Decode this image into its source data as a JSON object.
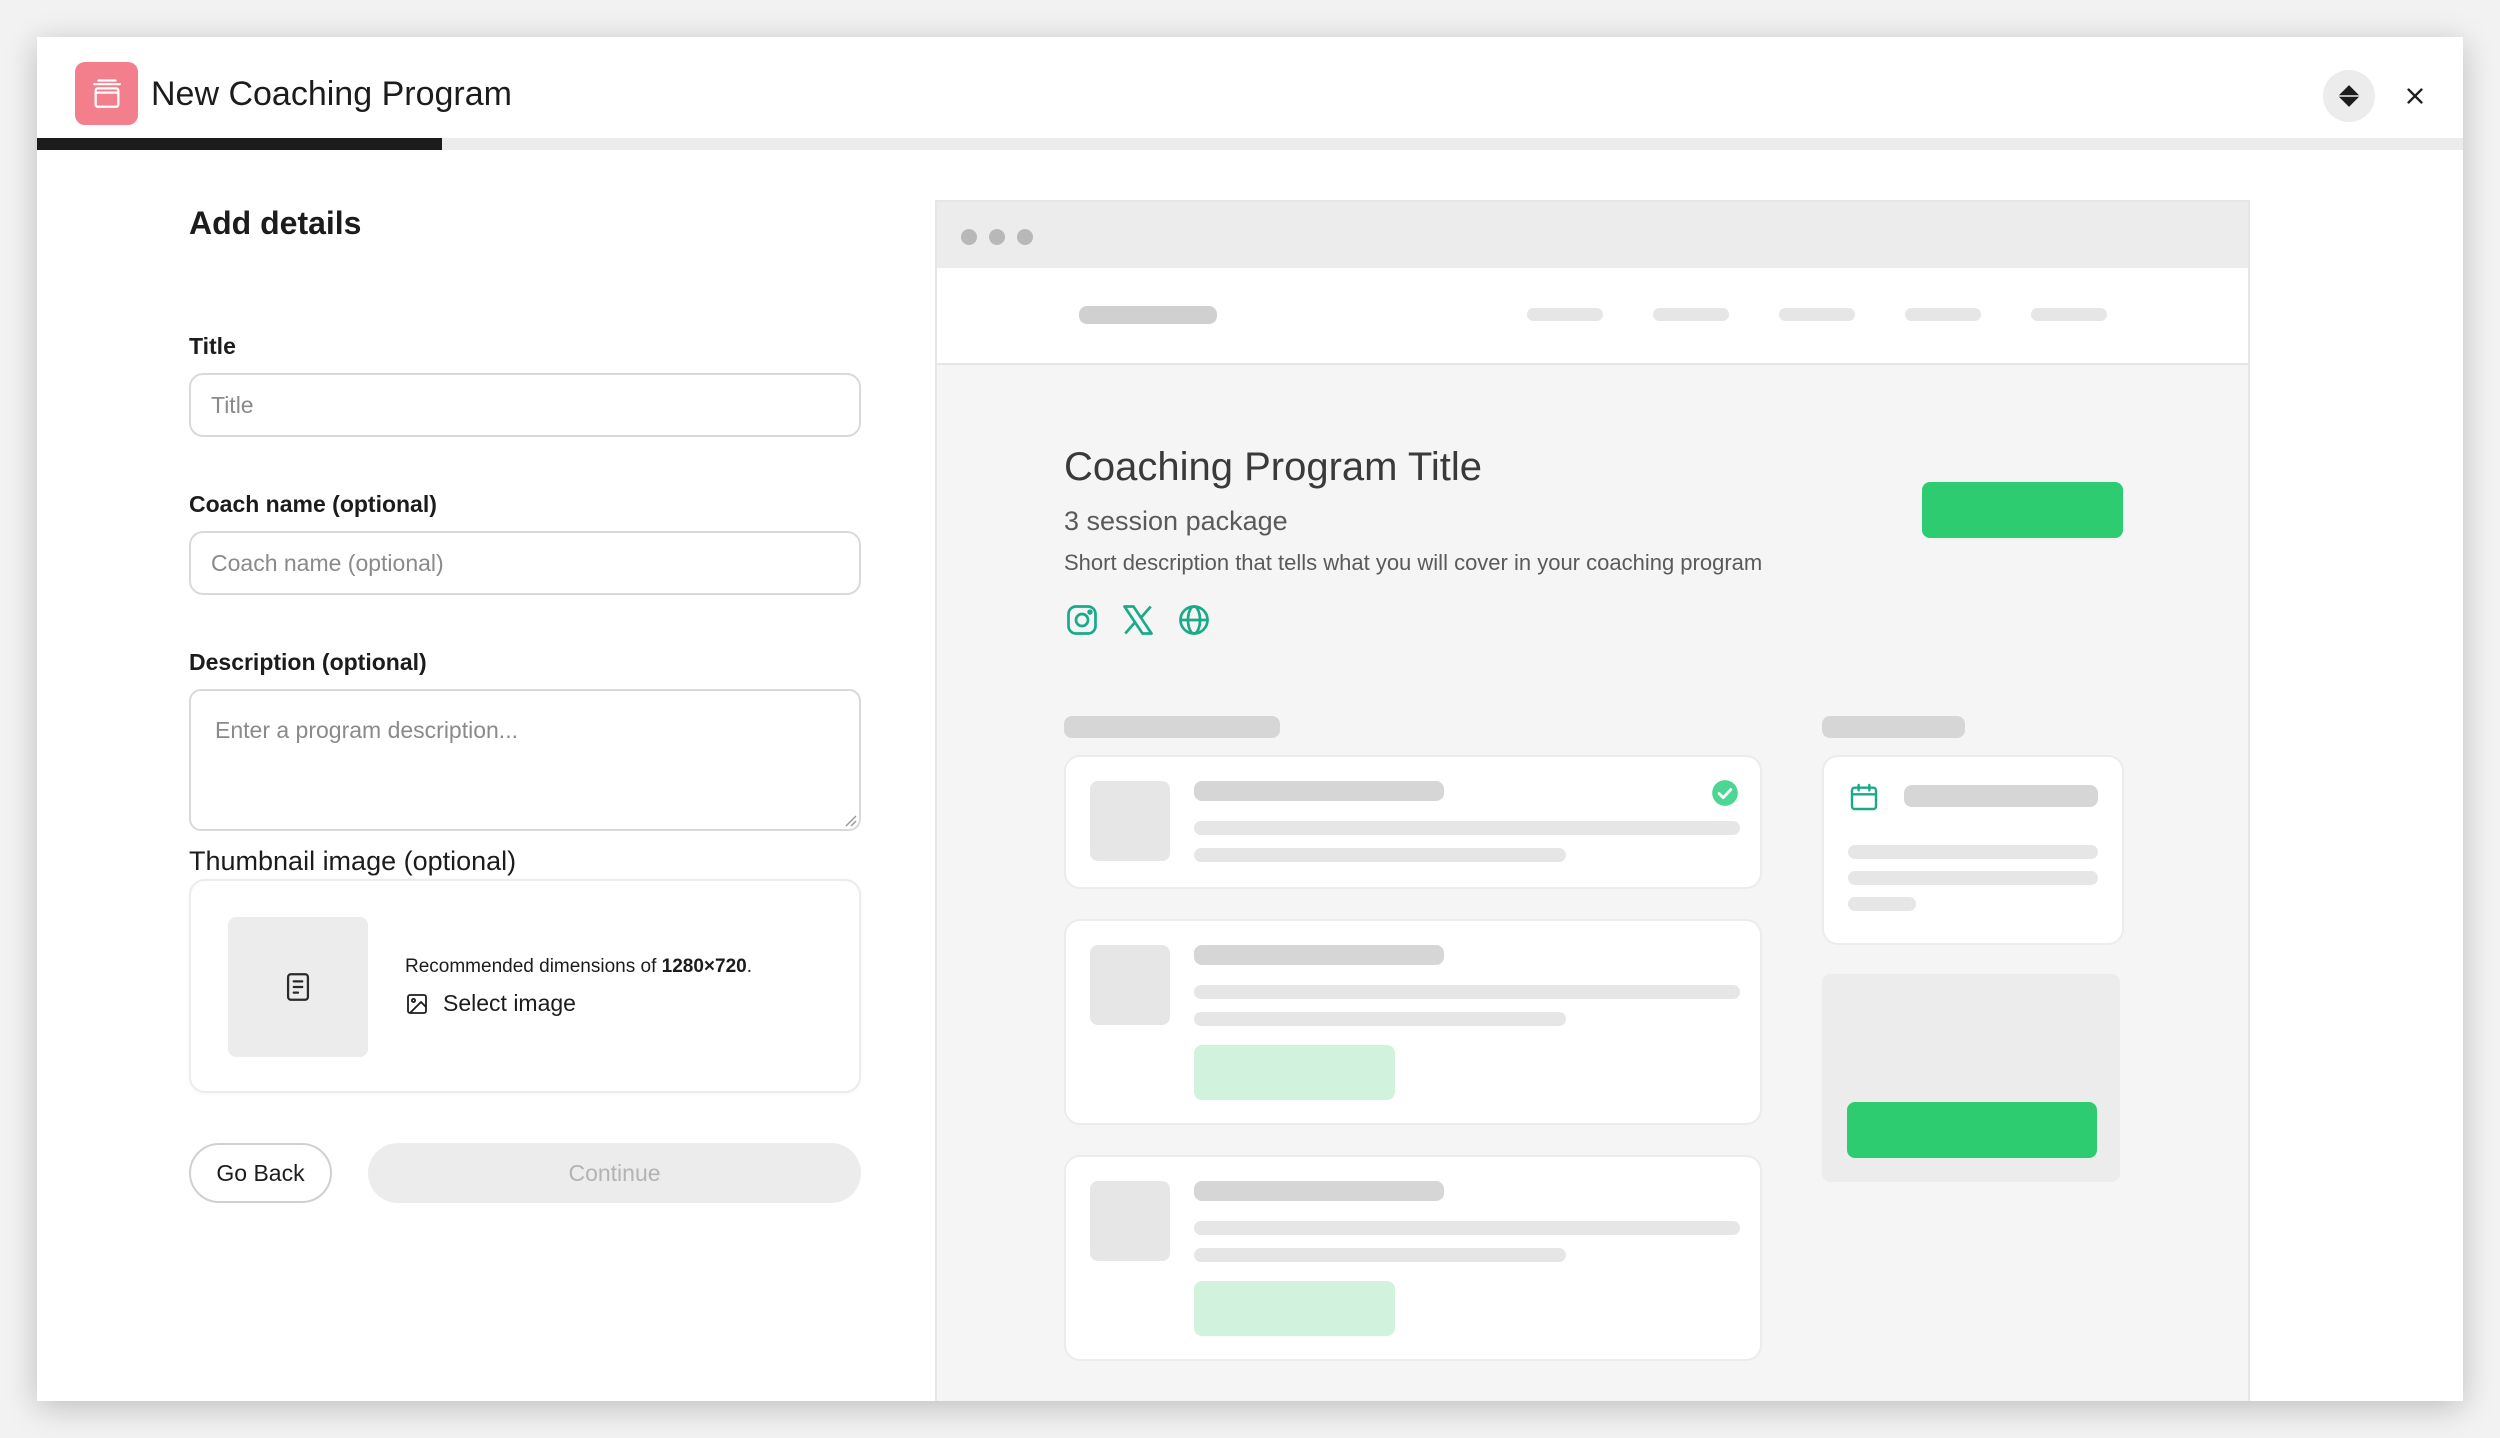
{
  "header": {
    "title": "New Coaching Program",
    "app_icon": "trash-box-icon",
    "diamond_icon": "diamond-icon",
    "close_icon": "close-icon",
    "progress": 0.167
  },
  "form": {
    "heading": "Add details",
    "title_label": "Title",
    "title_placeholder": "Title",
    "title_value": "",
    "coach_label": "Coach name (optional)",
    "coach_placeholder": "Coach name (optional)",
    "coach_value": "",
    "description_label": "Description (optional)",
    "description_placeholder": "Enter a program description...",
    "description_value": "",
    "thumbnail_label": "Thumbnail image (optional)",
    "recommended_prefix": "Recommended dimensions of ",
    "recommended_dims": "1280×720",
    "recommended_suffix": ".",
    "select_image": "Select image",
    "back_button": "Go Back",
    "continue_button": "Continue"
  },
  "preview": {
    "program_title": "Coaching Program Title",
    "session_package": "3 session package",
    "description": "Short description that tells what you will cover in your coaching program",
    "social_icons": [
      "instagram-icon",
      "x-icon",
      "globe-icon"
    ],
    "accent_color": "#2ecc71",
    "accent_light": "#d1f3de",
    "icon_color": "#1aaa8a"
  }
}
